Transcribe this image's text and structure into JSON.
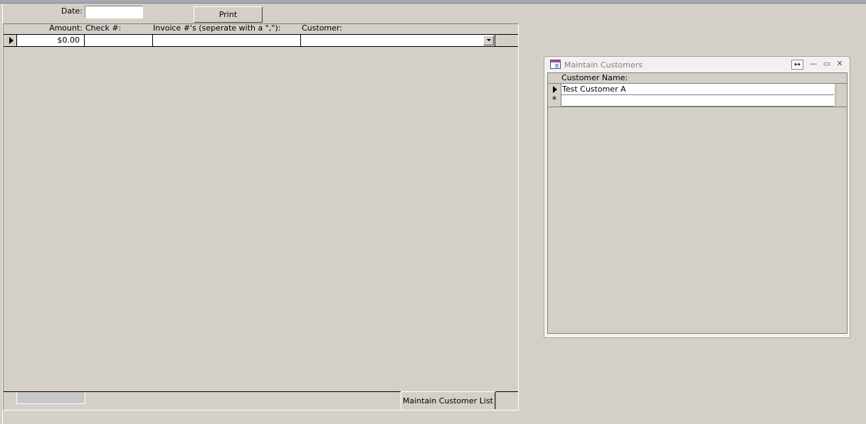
{
  "header": {
    "date_label": "Date:",
    "date_value": "",
    "print_label": "Print"
  },
  "grid": {
    "columns": [
      "Amount:",
      "Check #:",
      "Invoice #'s (seperate with a \",\"):",
      "Customer:"
    ],
    "row": {
      "amount": "$0.00",
      "check": "",
      "invoice": "",
      "customer": ""
    }
  },
  "footer": {
    "tab_label": "Maintain Customer List"
  },
  "child_window": {
    "title": "Maintain Customers",
    "controls": {
      "resize": "↔",
      "minimize": "—",
      "maximize": "▭",
      "close": "✕"
    },
    "column": "Customer Name:",
    "rows": [
      "Test Customer A"
    ],
    "new_record_marker": "*"
  }
}
